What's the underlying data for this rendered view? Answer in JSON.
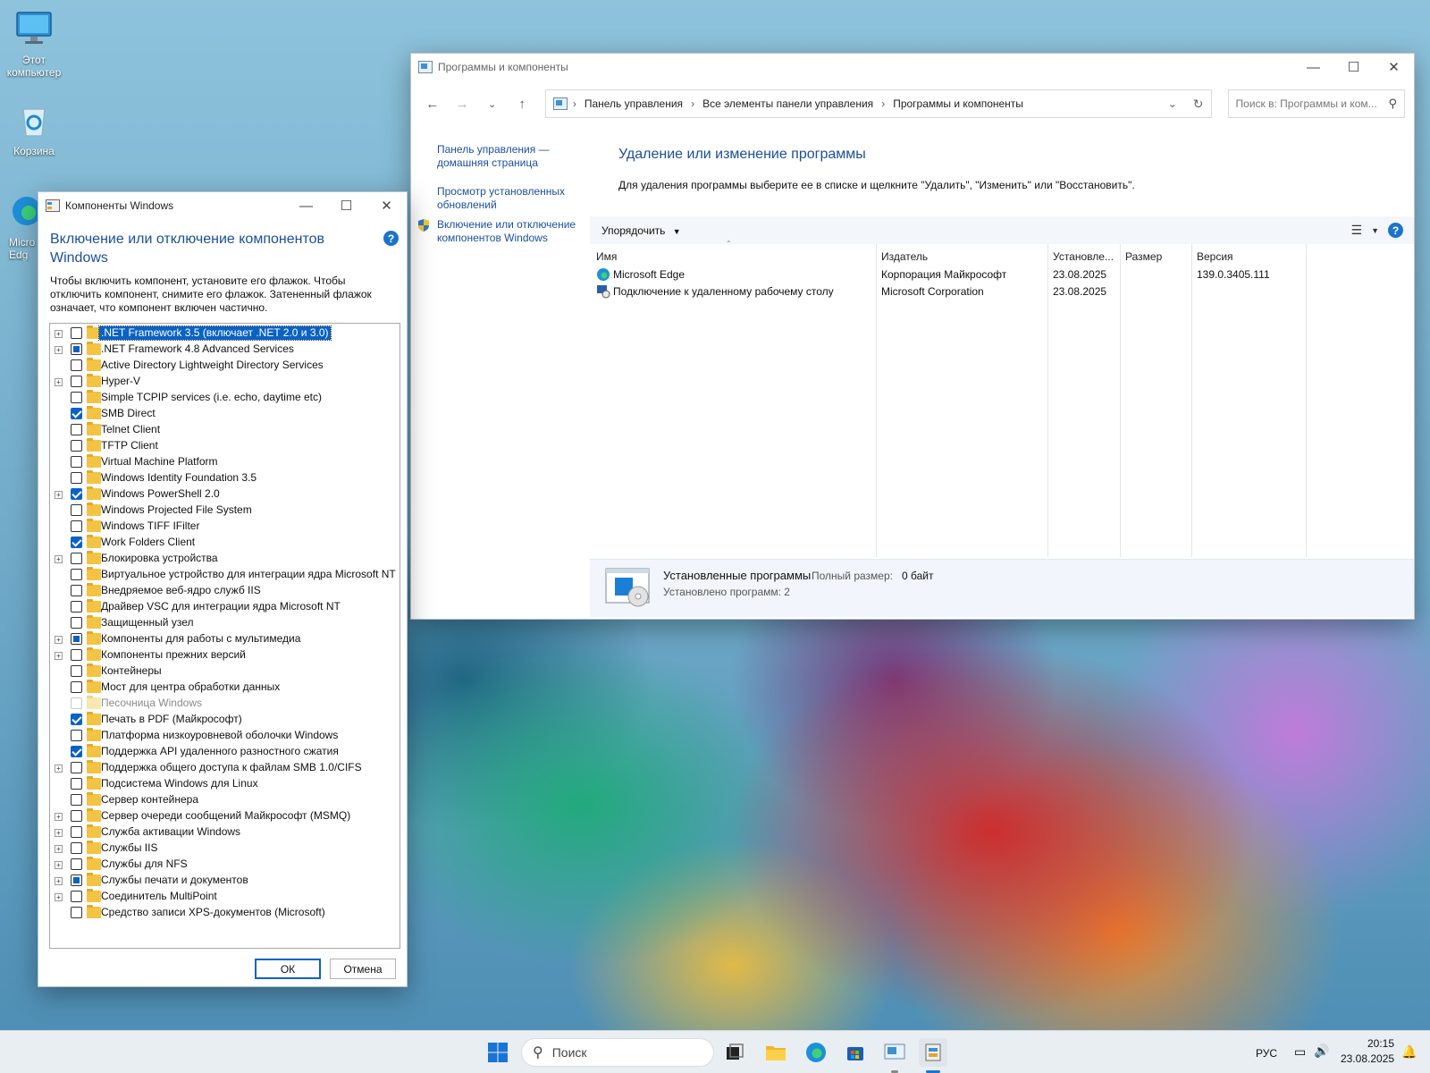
{
  "desktop": {
    "icons": [
      {
        "label": "Этот компьютер"
      },
      {
        "label": "Корзина"
      },
      {
        "label": "Micro Edg"
      }
    ]
  },
  "programs_window": {
    "title": "Программы и компоненты",
    "breadcrumb": [
      "Панель управления",
      "Все элементы панели управления",
      "Программы и компоненты"
    ],
    "search_placeholder": "Поиск в: Программы и ком...",
    "sidebar": {
      "home": "Панель управления — домашняя страница",
      "updates": "Просмотр установленных обновлений",
      "features": "Включение или отключение компонентов Windows"
    },
    "heading": "Удаление или изменение программы",
    "description": "Для удаления программы выберите ее в списке и щелкните \"Удалить\", \"Изменить\" или \"Восстановить\".",
    "organize": "Упорядочить",
    "columns": {
      "name": "Имя",
      "publisher": "Издатель",
      "installed": "Установле...",
      "size": "Размер",
      "version": "Версия"
    },
    "rows": [
      {
        "name": "Microsoft Edge",
        "publisher": "Корпорация Майкрософт",
        "installed": "23.08.2025",
        "size": "",
        "version": "139.0.3405.111"
      },
      {
        "name": "Подключение к удаленному рабочему столу",
        "publisher": "Microsoft Corporation",
        "installed": "23.08.2025",
        "size": "",
        "version": ""
      }
    ],
    "status": {
      "title": "Установленные программы",
      "size_label": "Полный размер:",
      "size_value": "0 байт",
      "count": "Установлено программ: 2"
    }
  },
  "features_dialog": {
    "title": "Компоненты Windows",
    "heading": "Включение или отключение компонентов Windows",
    "description": "Чтобы включить компонент, установите его флажок. Чтобы отключить компонент, снимите его флажок. Затененный флажок означает, что компонент включен частично.",
    "ok": "ОК",
    "cancel": "Отмена",
    "items": [
      {
        "label": ".NET Framework 3.5 (включает .NET 2.0 и 3.0)",
        "state": "unchecked",
        "expand": true,
        "selected": true
      },
      {
        "label": ".NET Framework 4.8 Advanced Services",
        "state": "partial",
        "expand": true
      },
      {
        "label": "Active Directory Lightweight Directory Services",
        "state": "unchecked",
        "expand": false
      },
      {
        "label": "Hyper-V",
        "state": "unchecked",
        "expand": true
      },
      {
        "label": "Simple TCPIP services (i.e. echo, daytime etc)",
        "state": "unchecked",
        "expand": false
      },
      {
        "label": "SMB Direct",
        "state": "checked",
        "expand": false
      },
      {
        "label": "Telnet Client",
        "state": "unchecked",
        "expand": false
      },
      {
        "label": "TFTP Client",
        "state": "unchecked",
        "expand": false
      },
      {
        "label": "Virtual Machine Platform",
        "state": "unchecked",
        "expand": false
      },
      {
        "label": "Windows Identity Foundation 3.5",
        "state": "unchecked",
        "expand": false
      },
      {
        "label": "Windows PowerShell 2.0",
        "state": "checked",
        "expand": true
      },
      {
        "label": "Windows Projected File System",
        "state": "unchecked",
        "expand": false
      },
      {
        "label": "Windows TIFF IFilter",
        "state": "unchecked",
        "expand": false
      },
      {
        "label": "Work Folders Client",
        "state": "checked",
        "expand": false
      },
      {
        "label": "Блокировка устройства",
        "state": "unchecked",
        "expand": true
      },
      {
        "label": "Виртуальное устройство для интеграции ядра Microsoft NT",
        "state": "unchecked",
        "expand": false
      },
      {
        "label": "Внедряемое веб-ядро служб IIS",
        "state": "unchecked",
        "expand": false
      },
      {
        "label": "Драйвер VSC для интеграции ядра Microsoft NT",
        "state": "unchecked",
        "expand": false
      },
      {
        "label": "Защищенный узел",
        "state": "unchecked",
        "expand": false
      },
      {
        "label": "Компоненты для работы с мультимедиа",
        "state": "partial",
        "expand": true
      },
      {
        "label": "Компоненты прежних версий",
        "state": "unchecked",
        "expand": true
      },
      {
        "label": "Контейнеры",
        "state": "unchecked",
        "expand": false
      },
      {
        "label": "Мост для центра обработки данных",
        "state": "unchecked",
        "expand": false
      },
      {
        "label": "Песочница Windows",
        "state": "disabled",
        "expand": false
      },
      {
        "label": "Печать в PDF (Майкрософт)",
        "state": "checked",
        "expand": false
      },
      {
        "label": "Платформа низкоуровневой оболочки Windows",
        "state": "unchecked",
        "expand": false
      },
      {
        "label": "Поддержка API удаленного разностного сжатия",
        "state": "checked",
        "expand": false
      },
      {
        "label": "Поддержка общего доступа к файлам SMB 1.0/CIFS",
        "state": "unchecked",
        "expand": true
      },
      {
        "label": "Подсистема Windows для Linux",
        "state": "unchecked",
        "expand": false
      },
      {
        "label": "Сервер контейнера",
        "state": "unchecked",
        "expand": false
      },
      {
        "label": "Сервер очереди сообщений Майкрософт (MSMQ)",
        "state": "unchecked",
        "expand": true
      },
      {
        "label": "Служба активации Windows",
        "state": "unchecked",
        "expand": true
      },
      {
        "label": "Службы IIS",
        "state": "unchecked",
        "expand": true
      },
      {
        "label": "Службы для NFS",
        "state": "unchecked",
        "expand": true
      },
      {
        "label": "Службы печати и документов",
        "state": "partial",
        "expand": true
      },
      {
        "label": "Соединитель MultiPoint",
        "state": "unchecked",
        "expand": true
      },
      {
        "label": "Средство записи XPS-документов (Microsoft)",
        "state": "unchecked",
        "expand": false
      }
    ]
  },
  "taskbar": {
    "search_placeholder": "Поиск",
    "language": "РУС",
    "time": "20:15",
    "date": "23.08.2025"
  },
  "colors": {
    "accent": "#0a62c4",
    "link": "#1b4f97",
    "folder": "#f3c343"
  }
}
